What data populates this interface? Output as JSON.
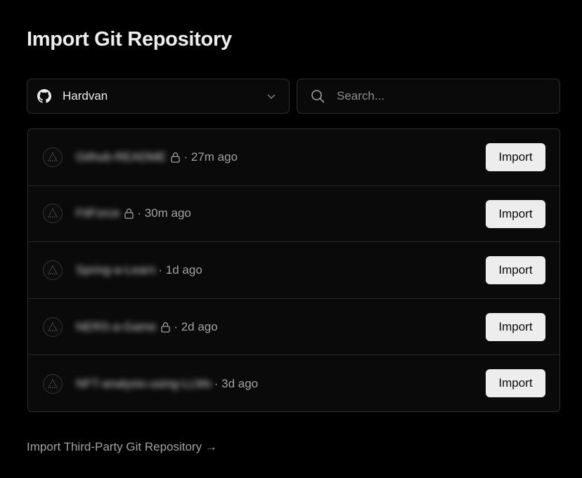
{
  "page": {
    "title": "Import Git Repository"
  },
  "account": {
    "name": "Hardvan",
    "icon": "github-icon"
  },
  "search": {
    "placeholder": "Search..."
  },
  "repos": [
    {
      "name": "Github-README",
      "private": true,
      "meta": "· 27m ago",
      "import_label": "Import"
    },
    {
      "name": "FitForce",
      "private": true,
      "meta": "· 30m ago",
      "import_label": "Import"
    },
    {
      "name": "Spring-a-Learn",
      "private": false,
      "meta": "· 1d ago",
      "import_label": "Import"
    },
    {
      "name": "NERS-a-Game",
      "private": true,
      "meta": "· 2d ago",
      "import_label": "Import"
    },
    {
      "name": "NFT-analysis-using-LLMs",
      "private": false,
      "meta": "· 3d ago",
      "import_label": "Import"
    }
  ],
  "footer": {
    "third_party_label": "Import Third-Party Git Repository →"
  },
  "colors": {
    "background": "#000000",
    "surface": "#0a0a0a",
    "border": "#2e2e2e",
    "button": "#ededed",
    "muted": "#a1a1a1"
  }
}
